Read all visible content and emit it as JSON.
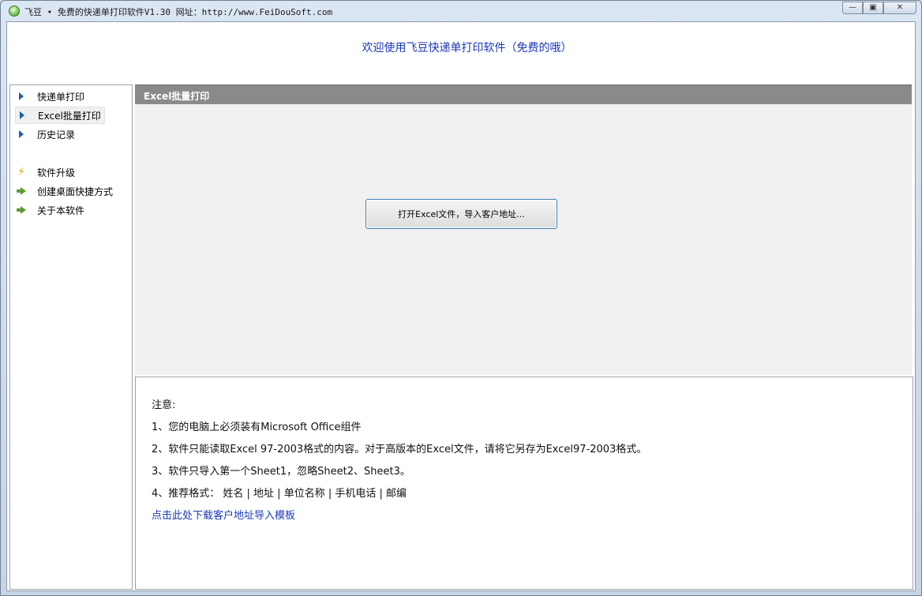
{
  "window": {
    "title": "飞豆 • 免费的快递单打印软件V1.30  网址：http://www.FeiDouSoft.com",
    "controls": {
      "minimize": "—",
      "restore": "▣",
      "close": "✕"
    }
  },
  "banner": {
    "welcome": "欢迎使用飞豆快递单打印软件（免费的哦）"
  },
  "sidebar": {
    "items": [
      {
        "label": "快递单打印",
        "icon": "triangle-right-icon"
      },
      {
        "label": "Excel批量打印",
        "icon": "triangle-right-icon",
        "selected": true
      },
      {
        "label": "历史记录",
        "icon": "triangle-right-icon"
      },
      {
        "label": "软件升级",
        "icon": "lightning-icon"
      },
      {
        "label": "创建桌面快捷方式",
        "icon": "green-arrow-icon"
      },
      {
        "label": "关于本软件",
        "icon": "green-arrow-icon"
      }
    ]
  },
  "main": {
    "header": "Excel批量打印",
    "open_button": "打开Excel文件，导入客户地址..."
  },
  "notes": {
    "title": "注意:",
    "lines": [
      "1、您的电脑上必须装有Microsoft Office组件",
      "2、软件只能读取Excel 97-2003格式的内容。对于高版本的Excel文件，请将它另存为Excel97-2003格式。",
      "3、软件只导入第一个Sheet1，忽略Sheet2、Sheet3。",
      "4、推荐格式：  姓名 | 地址 | 单位名称 | 手机电话 | 邮编"
    ],
    "download_link": "点击此处下载客户地址导入模板"
  },
  "colors": {
    "link": "#1c39b8",
    "header_bg": "#8a8a8a",
    "button_border": "#3c7fb1"
  }
}
